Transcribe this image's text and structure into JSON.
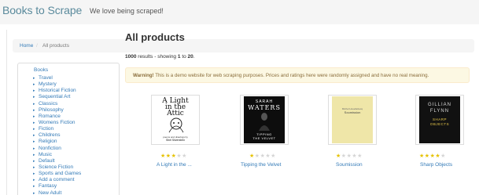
{
  "header": {
    "brand": "Books to Scrape",
    "tagline": "We love being scraped!"
  },
  "breadcrumb": {
    "home": "Home",
    "separator": "/",
    "current": "All products"
  },
  "sidebar": {
    "top_label": "Books",
    "categories": [
      "Travel",
      "Mystery",
      "Historical Fiction",
      "Sequential Art",
      "Classics",
      "Philosophy",
      "Romance",
      "Womens Fiction",
      "Fiction",
      "Childrens",
      "Religion",
      "Nonfiction",
      "Music",
      "Default",
      "Science Fiction",
      "Sports and Games",
      "Add a comment",
      "Fantasy",
      "New Adult"
    ]
  },
  "main": {
    "title": "All products",
    "results_count": "1000",
    "results_mid": "results - showing",
    "results_from": "1",
    "results_to_word": "to",
    "results_to": "20",
    "results_end": ".",
    "alert_strong": "Warning!",
    "alert_text": "This is a demo website for web scraping purposes. Prices and ratings here were randomly assigned and have no real meaning."
  },
  "products": [
    {
      "title": "A Light in the ...",
      "rating": 3,
      "cover": {
        "line1": "A Light",
        "line2": "in the",
        "line3": "Attic",
        "byline": "poems and drawings by",
        "author": "Shel Silverstein"
      }
    },
    {
      "title": "Tipping the Velvet",
      "rating": 1,
      "cover": {
        "author1": "SARAH",
        "author2": "WATERS",
        "title1": "TIPPING",
        "title2": "THE VELVET"
      }
    },
    {
      "title": "Soumission",
      "rating": 1,
      "cover": {
        "author": "Michel Houellebecq",
        "title": "Soumission"
      }
    },
    {
      "title": "Sharp Objects",
      "rating": 4,
      "cover": {
        "author1": "GILLIAN",
        "author2": "FLYNN",
        "title1": "SHARP",
        "title2": "OBJECTS"
      }
    }
  ],
  "colors": {
    "brand": "#5a8a9c",
    "link": "#337ab7",
    "star_on": "#e6c200",
    "star_off": "#d5d5d5",
    "alert_bg": "#fcf8e3",
    "alert_text": "#8a6d3b"
  },
  "star_glyph": "★"
}
